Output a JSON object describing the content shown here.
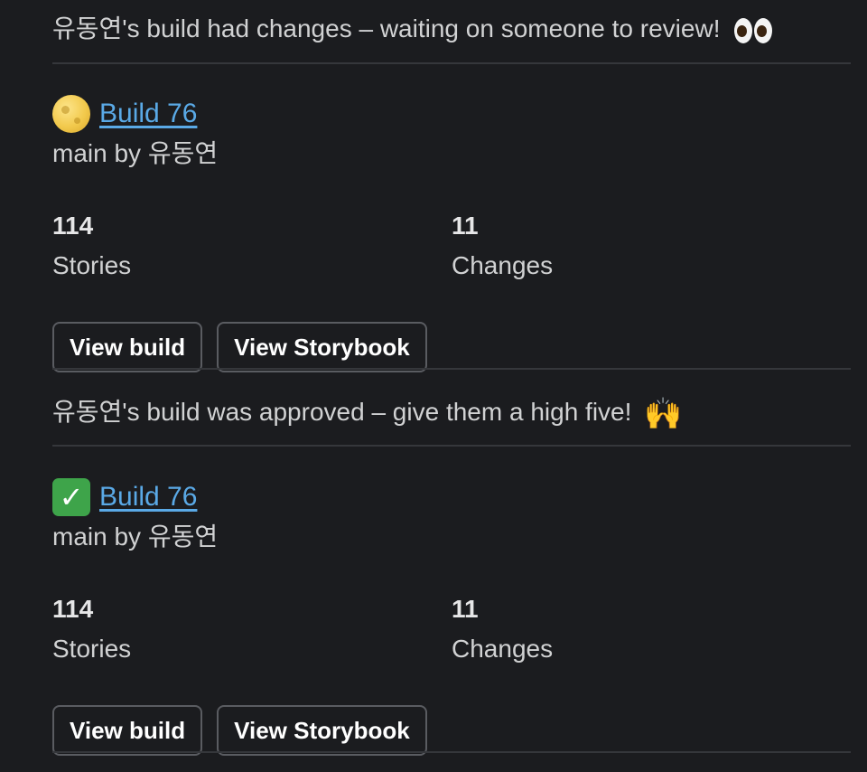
{
  "notices": [
    {
      "text": "유동연's build had changes – waiting on someone to review!",
      "emoji_icon": "eyes-icon"
    },
    {
      "text": "유동연's build was approved – give them a high five!",
      "emoji_icon": "raised-hands-icon",
      "emoji_glyph": "🙌"
    }
  ],
  "cards": [
    {
      "status_icon": "full-moon-icon",
      "build_label": "Build 76",
      "meta": "main by 유동연",
      "stats": {
        "stories_value": "114",
        "stories_label": "Stories",
        "changes_value": "11",
        "changes_label": "Changes"
      },
      "buttons": {
        "view_build": "View build",
        "view_storybook": "View Storybook"
      }
    },
    {
      "status_icon": "check-mark-icon",
      "status_glyph": "✓",
      "build_label": "Build 76",
      "meta": "main by 유동연",
      "stats": {
        "stories_value": "114",
        "stories_label": "Stories",
        "changes_value": "11",
        "changes_label": "Changes"
      },
      "buttons": {
        "view_build": "View build",
        "view_storybook": "View Storybook"
      }
    }
  ],
  "colors": {
    "background": "#1b1c1f",
    "link": "#5aa9e6",
    "divider": "#35373b",
    "button_border": "#5a5c61",
    "check_green": "#3ea44a"
  }
}
